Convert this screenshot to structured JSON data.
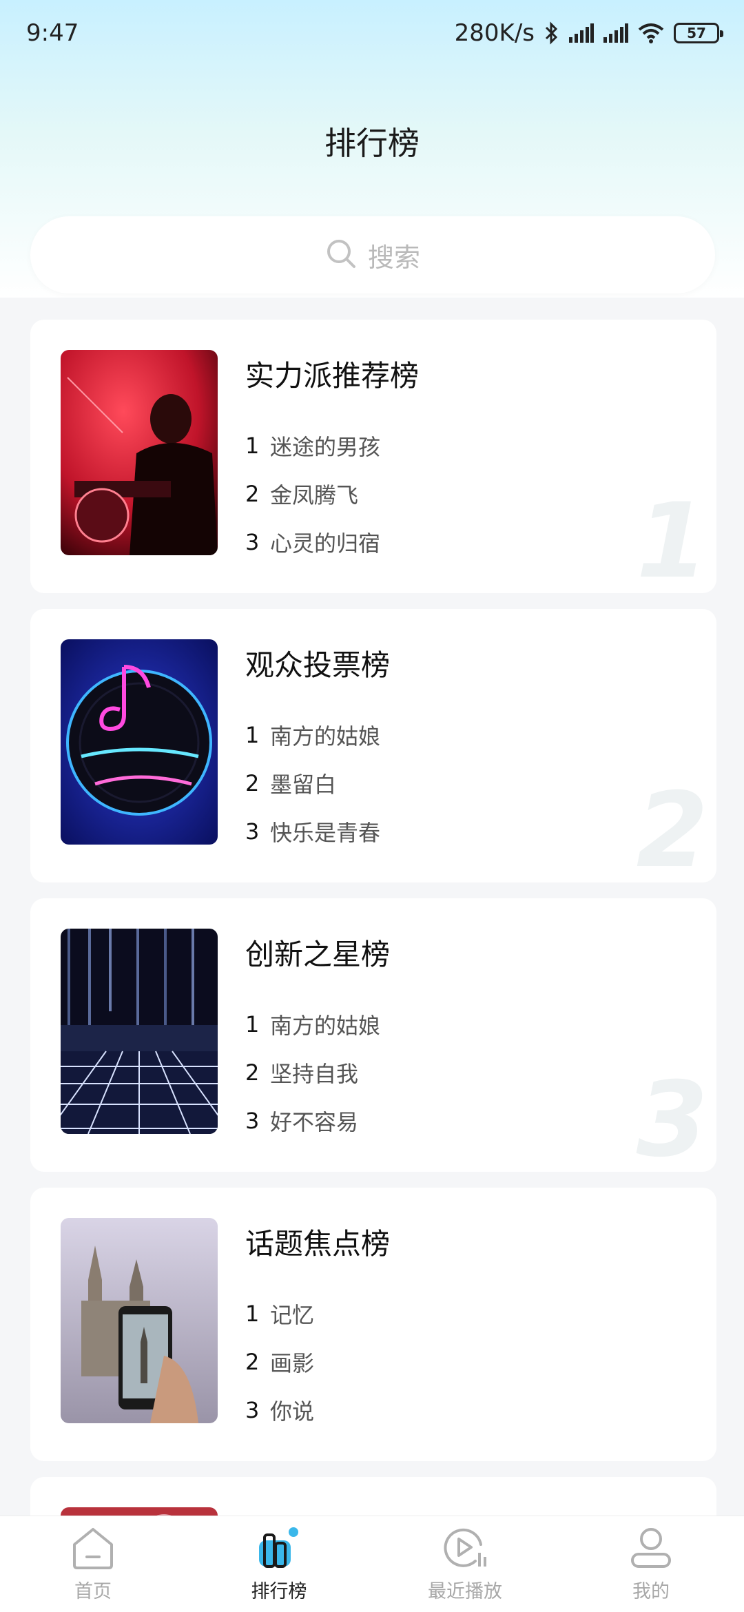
{
  "status_bar": {
    "time": "9:47",
    "net_speed": "280K/s",
    "battery": "57"
  },
  "header": {
    "title": "排行榜"
  },
  "search": {
    "placeholder": "搜索"
  },
  "charts": [
    {
      "title": "实力派推荐榜",
      "rank_label": "1",
      "songs": [
        {
          "rank": "1",
          "name": "迷途的男孩"
        },
        {
          "rank": "2",
          "name": "金凤腾飞"
        },
        {
          "rank": "3",
          "name": "心灵的归宿"
        }
      ]
    },
    {
      "title": "观众投票榜",
      "rank_label": "2",
      "songs": [
        {
          "rank": "1",
          "name": "南方的姑娘"
        },
        {
          "rank": "2",
          "name": "墨留白"
        },
        {
          "rank": "3",
          "name": "快乐是青春"
        }
      ]
    },
    {
      "title": "创新之星榜",
      "rank_label": "3",
      "songs": [
        {
          "rank": "1",
          "name": "南方的姑娘"
        },
        {
          "rank": "2",
          "name": "坚持自我"
        },
        {
          "rank": "3",
          "name": "好不容易"
        }
      ]
    },
    {
      "title": "话题焦点榜",
      "rank_label": "",
      "songs": [
        {
          "rank": "1",
          "name": "记忆"
        },
        {
          "rank": "2",
          "name": "画影"
        },
        {
          "rank": "3",
          "name": "你说"
        }
      ]
    }
  ],
  "bottom_nav": [
    {
      "label": "首页",
      "icon": "home-icon",
      "active": false
    },
    {
      "label": "排行榜",
      "icon": "ranking-icon",
      "active": true
    },
    {
      "label": "最近播放",
      "icon": "recent-play-icon",
      "active": false
    },
    {
      "label": "我的",
      "icon": "profile-icon",
      "active": false
    }
  ],
  "colors": {
    "accent": "#3ab7ea",
    "header_gradient_top": "#c8f0ff"
  }
}
